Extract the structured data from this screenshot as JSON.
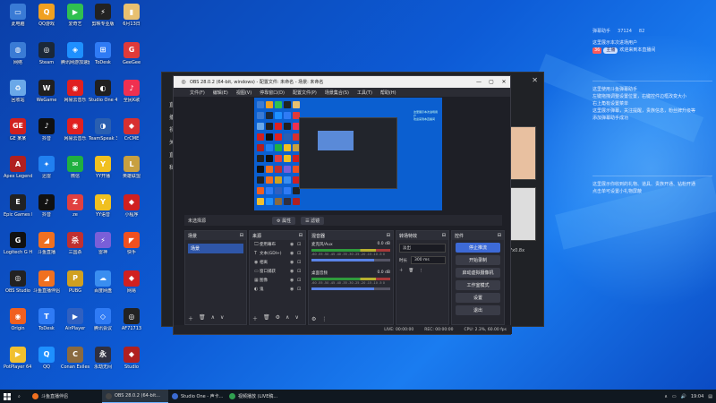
{
  "desktop_icons": [
    {
      "label": "此电脑",
      "color": "#3a7bd5",
      "glyph": "▭"
    },
    {
      "label": "QQ游戏",
      "color": "#f0a020",
      "glyph": "Q"
    },
    {
      "label": "爱奇艺",
      "color": "#30c050",
      "glyph": "▶"
    },
    {
      "label": "剪映专业版",
      "color": "#222222",
      "glyph": "⚡"
    },
    {
      "label": "6月13日",
      "color": "#e8c070",
      "glyph": "▮"
    },
    {
      "label": "网络",
      "color": "#3a7bd5",
      "glyph": "◍"
    },
    {
      "label": "Steam",
      "color": "#1b2838",
      "glyph": "◎"
    },
    {
      "label": "腾讯网游加速器",
      "color": "#1e90ff",
      "glyph": "◈"
    },
    {
      "label": "ToDesk",
      "color": "#2f7bf5",
      "glyph": "⊞"
    },
    {
      "label": "GeeGee",
      "color": "#e03a3a",
      "glyph": "G"
    },
    {
      "label": "回收站",
      "color": "#6aa8e8",
      "glyph": "♻"
    },
    {
      "label": "WeGame",
      "color": "#202020",
      "glyph": "W"
    },
    {
      "label": "网易云音乐",
      "color": "#e02020",
      "glyph": "◉"
    },
    {
      "label": "Studio One 4",
      "color": "#202020",
      "glyph": "◐"
    },
    {
      "label": "全民K歌",
      "color": "#f03050",
      "glyph": "♪"
    },
    {
      "label": "GE 某某",
      "color": "#d02020",
      "glyph": "GE"
    },
    {
      "label": "抖音",
      "color": "#111111",
      "glyph": "♪"
    },
    {
      "label": "网易云音乐",
      "color": "#e02020",
      "glyph": "◉"
    },
    {
      "label": "TeamSpeak 3",
      "color": "#2a5fb0",
      "glyph": "◑"
    },
    {
      "label": "CrCME",
      "color": "#d83030",
      "glyph": "◆"
    },
    {
      "label": "Apex Legends",
      "color": "#b02020",
      "glyph": "A"
    },
    {
      "label": "迅雷",
      "color": "#2080f0",
      "glyph": "✦"
    },
    {
      "label": "微信",
      "color": "#20b040",
      "glyph": "✉"
    },
    {
      "label": "YY开播",
      "color": "#f0c020",
      "glyph": "Y"
    },
    {
      "label": "英雄联盟",
      "color": "#c8a040",
      "glyph": "L"
    },
    {
      "label": "Epic Games Launcher",
      "color": "#222222",
      "glyph": "E"
    },
    {
      "label": "抖音",
      "color": "#111111",
      "glyph": "♪"
    },
    {
      "label": "ze",
      "color": "#e04040",
      "glyph": "Z"
    },
    {
      "label": "YY语音",
      "color": "#f0c020",
      "glyph": "Y"
    },
    {
      "label": "小程序",
      "color": "#d02020",
      "glyph": "◆"
    },
    {
      "label": "Logitech G HUB",
      "color": "#111111",
      "glyph": "G"
    },
    {
      "label": "斗鱼直播",
      "color": "#f07020",
      "glyph": "◢"
    },
    {
      "label": "三国杀",
      "color": "#c03030",
      "glyph": "杀"
    },
    {
      "label": "雷神",
      "color": "#7a5fd8",
      "glyph": "⚡"
    },
    {
      "label": "快手",
      "color": "#f05020",
      "glyph": "◤"
    },
    {
      "label": "OBS Studio",
      "color": "#222222",
      "glyph": "◎"
    },
    {
      "label": "斗鱼直播伴侣",
      "color": "#f07020",
      "glyph": "◢"
    },
    {
      "label": "PUBG",
      "color": "#d0a020",
      "glyph": "P"
    },
    {
      "label": "百度网盘",
      "color": "#3a8ef0",
      "glyph": "☁"
    },
    {
      "label": "网易",
      "color": "#d02020",
      "glyph": "◆"
    },
    {
      "label": "Origin",
      "color": "#f06020",
      "glyph": "◉"
    },
    {
      "label": "ToDesk",
      "color": "#2f7bf5",
      "glyph": "T"
    },
    {
      "label": "AirPlayer",
      "color": "#3060c0",
      "glyph": "▶"
    },
    {
      "label": "腾讯会议",
      "color": "#2f7bf5",
      "glyph": "◇"
    },
    {
      "label": "AF71713",
      "color": "#222222",
      "glyph": "◎"
    },
    {
      "label": "PotPlayer 64 bit",
      "color": "#f0c030",
      "glyph": "▶"
    },
    {
      "label": "QQ",
      "color": "#1e90ff",
      "glyph": "Q"
    },
    {
      "label": "Conan Exiles",
      "color": "#8a6a40",
      "glyph": "C"
    },
    {
      "label": "永劫无间",
      "color": "#303040",
      "glyph": "永"
    },
    {
      "label": "Studio",
      "color": "#b02020",
      "glyph": "◆"
    }
  ],
  "taskbar": {
    "items": [
      {
        "label": "斗鱼直播伴侣",
        "color": "#f07020"
      },
      {
        "label": "OBS 28.0.2 (64-bit...",
        "color": "#444444"
      },
      {
        "label": "Studio One - 声卡...",
        "color": "#3a6ad0"
      },
      {
        "label": "视频播放 (LIVE稿...",
        "color": "#30a050"
      }
    ],
    "clock": "19:04"
  },
  "chat": {
    "header": {
      "left": "弹幕助手",
      "fans": "37124",
      "gift": "82"
    },
    "messages": [
      "这里展示本次进场用户",
      "欢迎来到本直播间",
      "这里使用斗鱼弹幕助手",
      "左键拖拽调整设置位置，右键控件边框改变大小",
      "右上角有设置菜单",
      "这里展示弹幕，关注提醒，贵族信息，粉丝牌升级等",
      "添加弹幕助手成功",
      "这里展示你收到的礼物、道具、贵族开通、钻粉开通",
      "点击单可设置小礼物屏蔽"
    ],
    "badge": "36",
    "pill": "主播"
  },
  "bgapp": {
    "side_items": [
      "直播",
      "播放",
      "视频",
      "关注",
      "直播",
      "私人"
    ],
    "close": "✕",
    "thumb_label": "7x0.8x"
  },
  "obs": {
    "title": "OBS 28.0.2 (64-bit, windows) - 配置文件: 未命名 - 场景: 未命名",
    "menu": [
      "文件(F)",
      "编辑(E)",
      "视图(V)",
      "停靠窗口(D)",
      "配置文件(P)",
      "场景集合(S)",
      "工具(T)",
      "帮助(H)"
    ],
    "ctrlbar": {
      "label": "未选择源",
      "props": "⚙ 属性",
      "filters": "☰ 滤镜"
    },
    "scenes": {
      "title": "场景",
      "items": [
        "场景"
      ]
    },
    "sources": {
      "title": "来源",
      "items": [
        {
          "name": "使用幕布",
          "icon": "🖵"
        },
        {
          "name": "文本(GDI+)",
          "icon": "T"
        },
        {
          "name": "相离",
          "icon": "◉"
        },
        {
          "name": "窗口捕获",
          "icon": "▭"
        },
        {
          "name": "图像",
          "icon": "▦"
        },
        {
          "name": "鬼",
          "icon": "◐"
        }
      ]
    },
    "mixer": {
      "title": "混音器",
      "tracks": [
        {
          "name": "麦克风/Aux",
          "db": "0.0 dB"
        },
        {
          "name": "桌面音频",
          "db": "0.0 dB"
        }
      ],
      "scale": "-60 -55 -50 -45 -40 -35 -30 -25 -20 -15 -10 -5 0"
    },
    "transitions": {
      "title": "转场特效",
      "type": "淡出",
      "duration_label": "时长",
      "duration": "300 ms"
    },
    "controls": {
      "title": "控件",
      "buttons": [
        "停止推流",
        "开始录制",
        "启动虚拟摄像机",
        "工作室模式",
        "设置",
        "退出"
      ]
    },
    "status": {
      "live": "LIVE: 00:00:00",
      "rec": "REC: 00:00:00",
      "cpu": "CPU: 2.3%, 60.00 fps"
    }
  }
}
